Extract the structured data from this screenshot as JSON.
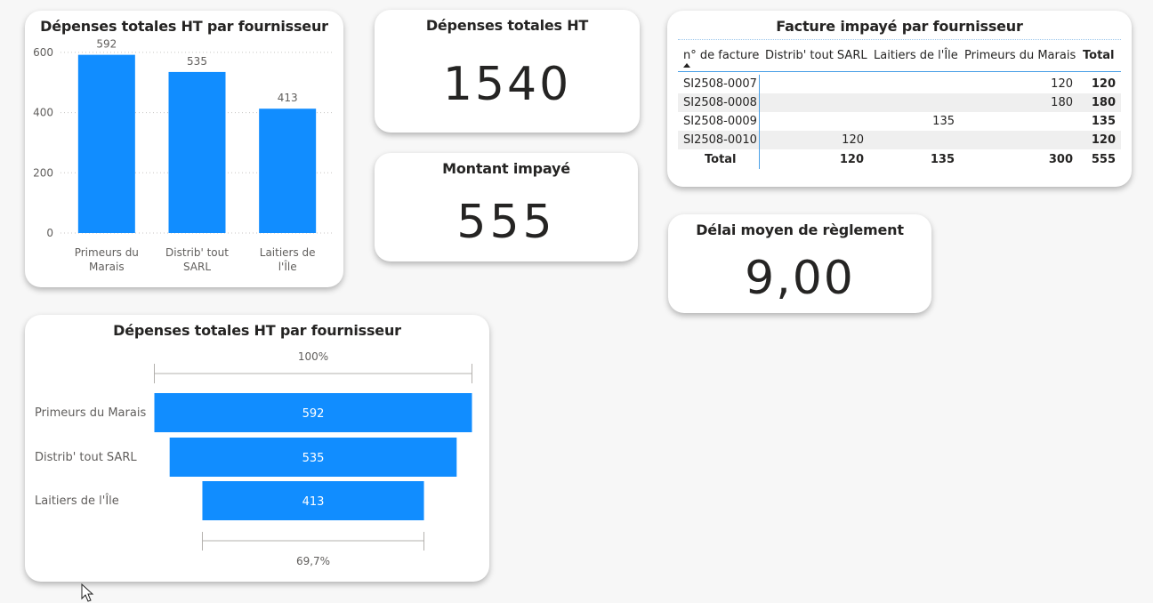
{
  "column_chart": {
    "title": "Dépenses totales HT par fournisseur",
    "chart_data": {
      "type": "bar",
      "categories": [
        [
          "Primeurs du",
          "Marais"
        ],
        [
          "Distrib' tout",
          "SARL"
        ],
        [
          "Laitiers de",
          "l'Île"
        ]
      ],
      "values": [
        592,
        535,
        413
      ],
      "value_labels": [
        "592",
        "535",
        "413"
      ],
      "yticks": [
        "0",
        "200",
        "400",
        "600"
      ],
      "ylim": [
        0,
        650
      ],
      "grid": true
    }
  },
  "kpi_total": {
    "title": "Dépenses totales HT",
    "value": "1540"
  },
  "kpi_unpaid": {
    "title": "Montant impayé",
    "value": "555"
  },
  "kpi_delay": {
    "title": "Délai moyen de règlement",
    "value": "9,00"
  },
  "matrix": {
    "title": "Facture impayé par fournisseur",
    "columns": [
      "n° de facture",
      "Distrib' tout SARL",
      "Laitiers de l'Île",
      "Primeurs du Marais",
      "Total"
    ],
    "rows": [
      [
        "SI2508-0007",
        "",
        "",
        "120",
        "120"
      ],
      [
        "SI2508-0008",
        "",
        "",
        "180",
        "180"
      ],
      [
        "SI2508-0009",
        "",
        "135",
        "",
        "135"
      ],
      [
        "SI2508-0010",
        "120",
        "",
        "",
        "120"
      ]
    ],
    "total_row": [
      "Total",
      "120",
      "135",
      "300",
      "555"
    ]
  },
  "funnel": {
    "title": "Dépenses totales HT par fournisseur",
    "top_percent": "100%",
    "bottom_percent": "69,7%",
    "chart_data": {
      "type": "bar",
      "categories": [
        "Primeurs du Marais",
        "Distrib' tout SARL",
        "Laitiers de l'Île"
      ],
      "values": [
        592,
        535,
        413
      ],
      "value_labels": [
        "592",
        "535",
        "413"
      ]
    }
  },
  "colors": {
    "bar": "#118DFF",
    "text": "#252423",
    "axis_text": "#605E5C",
    "grid": "#C8C6C4"
  }
}
